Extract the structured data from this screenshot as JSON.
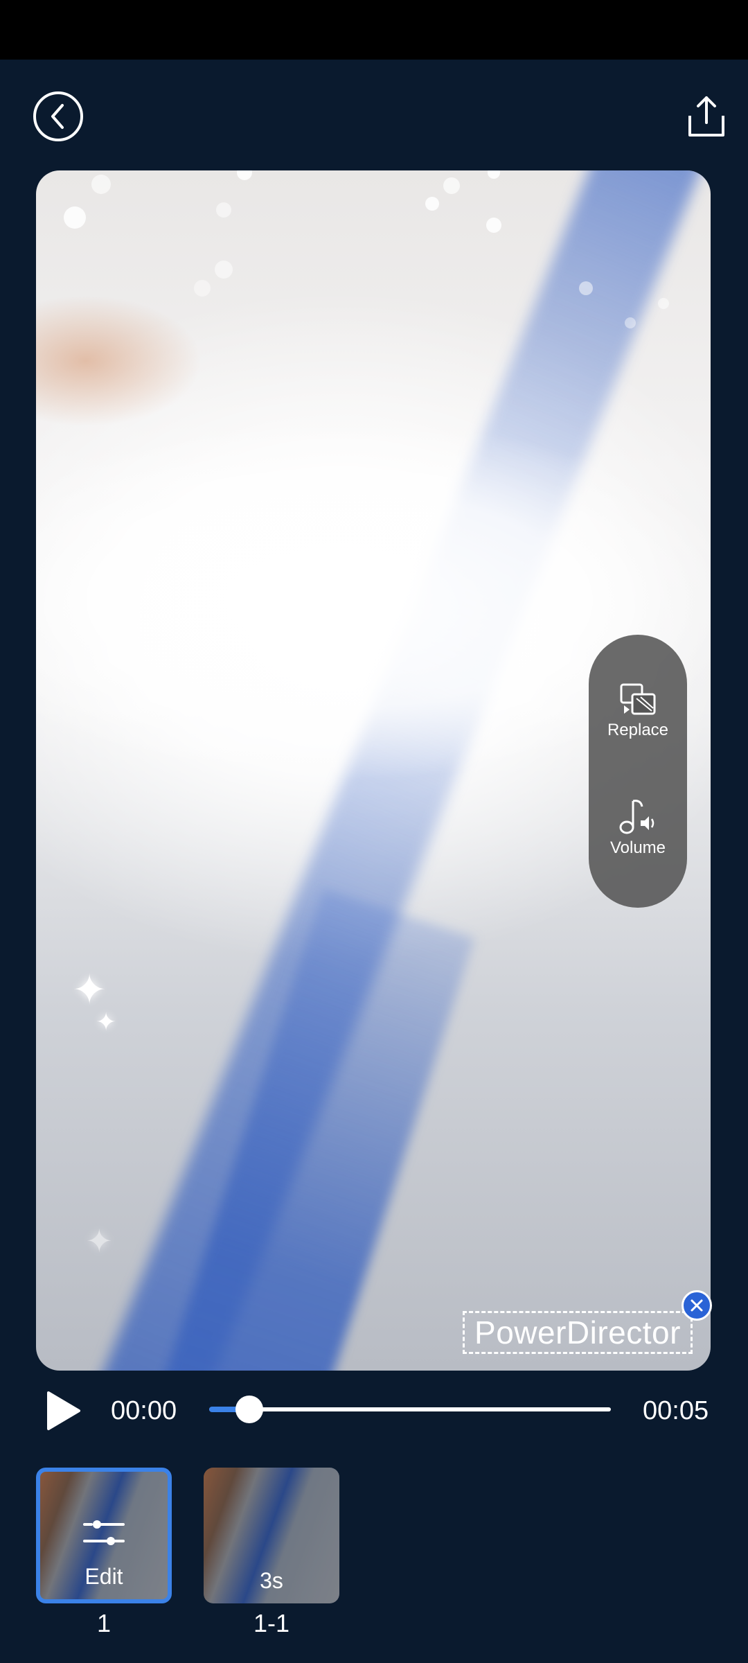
{
  "header": {
    "back_icon": "chevron-left-icon",
    "share_icon": "upload-share-icon"
  },
  "preview": {
    "side_panel": {
      "replace_label": "Replace",
      "volume_label": "Volume",
      "replace_icon": "replace-media-icon",
      "volume_icon": "music-volume-icon"
    },
    "watermark_text": "PowerDirector",
    "watermark_close_icon": "close-icon"
  },
  "playback": {
    "play_icon": "play-icon",
    "current_time": "00:00",
    "total_time": "00:05",
    "progress_fraction": 0.1
  },
  "clips": [
    {
      "label": "Edit",
      "number": "1",
      "icon": "sliders-icon",
      "selected": true
    },
    {
      "label": "3s",
      "number": "1-1",
      "selected": false
    }
  ],
  "colors": {
    "background": "#0a1a2e",
    "accent": "#3b82e8",
    "close_badge": "#2a63d6"
  }
}
